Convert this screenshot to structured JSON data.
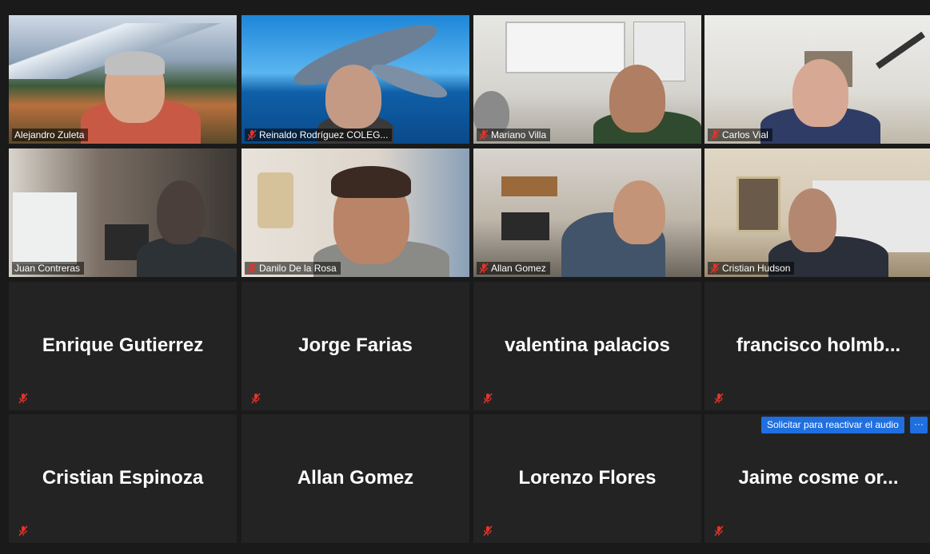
{
  "colors": {
    "active_speaker_border": "#c9e040",
    "accent_button": "#1f6fe0",
    "mute_red": "#e0352b"
  },
  "participants_video": [
    {
      "name": "Alejandro Zuleta",
      "muted": false,
      "active": true
    },
    {
      "name": "Reinaldo Rodríguez  COLEG...",
      "muted": true
    },
    {
      "name": "Mariano Villa",
      "muted": true
    },
    {
      "name": "Carlos Vial",
      "muted": true
    },
    {
      "name": "Juan Contreras",
      "muted": false
    },
    {
      "name": "Danilo De la Rosa",
      "muted": true
    },
    {
      "name": "Allan Gomez",
      "muted": true
    },
    {
      "name": "Cristian Hudson",
      "muted": true
    }
  ],
  "participants_no_video": [
    {
      "name": "Enrique Gutierrez",
      "muted": true
    },
    {
      "name": "Jorge Farias",
      "muted": true
    },
    {
      "name": "valentina palacios",
      "muted": true
    },
    {
      "name": "francisco  holmb...",
      "muted": true
    },
    {
      "name": "Cristian Espinoza",
      "muted": true
    },
    {
      "name": "Allan Gomez",
      "muted": true
    },
    {
      "name": "Lorenzo Flores",
      "muted": true
    },
    {
      "name": "Jaime cosme  or...",
      "muted": true
    }
  ],
  "unmute_request": {
    "label": "Solicitar para reactivar el audio",
    "more_label": "···"
  },
  "icons": {
    "mute": "muted-mic-icon",
    "more": "more-options-icon"
  }
}
